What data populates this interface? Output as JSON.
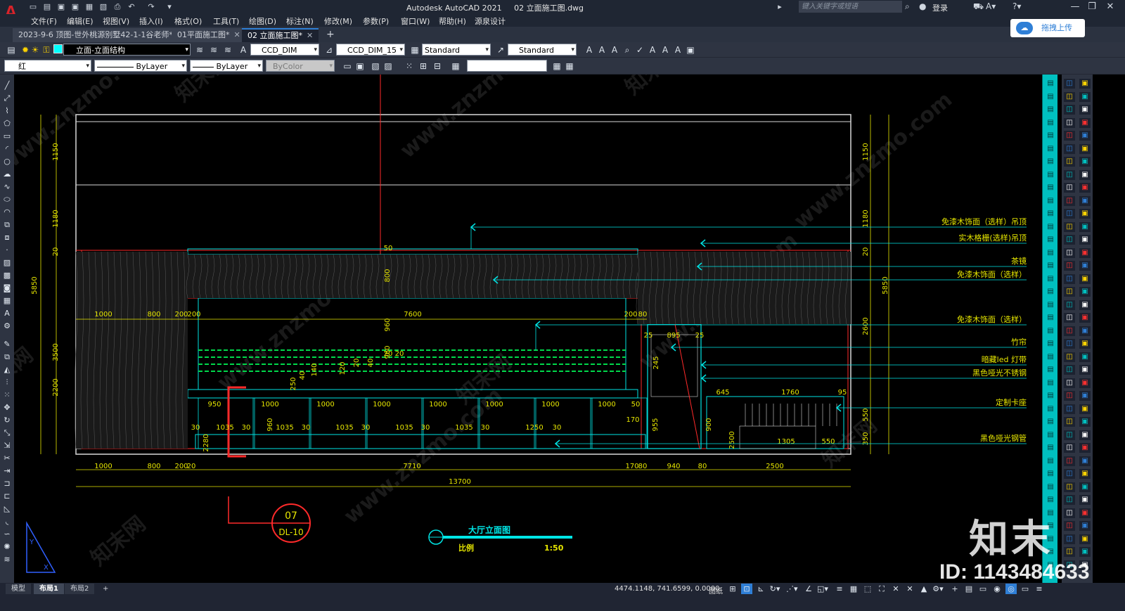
{
  "app": {
    "title": "Autodesk AutoCAD 2021     02 立面施工图.dwg",
    "search_placeholder": "键入关键字或短语",
    "login_label": "登录"
  },
  "menu": [
    "文件(F)",
    "编辑(E)",
    "视图(V)",
    "插入(I)",
    "格式(O)",
    "工具(T)",
    "绘图(D)",
    "标注(N)",
    "修改(M)",
    "参数(P)",
    "窗口(W)",
    "帮助(H)",
    "源泉设计"
  ],
  "tabs": [
    {
      "label": "2023-9-6 顶图-世外桃源别墅42-1-1谷老师*",
      "active": false
    },
    {
      "label": "01平面施工图*",
      "active": false
    },
    {
      "label": "02 立面施工图*",
      "active": true
    }
  ],
  "upload_button": "拖拽上传",
  "toolbar1": {
    "layer": "立面-立面结构",
    "text_style": "CCD_DIM",
    "dim_style": "CCD_DIM_15",
    "table_style": "Standard",
    "mleader_style": "Standard"
  },
  "toolbar2": {
    "color": "红",
    "color_hex": "#ff0000",
    "linetype": "ByLayer",
    "lineweight": "ByLayer",
    "plotstyle": "ByColor"
  },
  "drawing": {
    "title": "大厅立面图",
    "scale_label": "比例",
    "scale": "1:50",
    "symbol_code": "DL-10",
    "symbol_number": "07",
    "callouts": [
      "免漆木饰面（选样）吊顶",
      "实木格栅(选样)吊顶",
      "茶镜",
      "免漆木饰面（选样）",
      "免漆木饰面（选样）",
      "竹帘",
      "暗藏led 灯带",
      "黑色哑光不锈钢",
      "定制卡座",
      "黑色哑光钢管"
    ],
    "dims_top": [
      "1000",
      "800",
      "200",
      "200",
      "7600",
      "200",
      "80"
    ],
    "dims_bottom": [
      "1000",
      "800",
      "200",
      "20",
      "7710",
      "170",
      "80",
      "940",
      "80",
      "2500"
    ],
    "dim_total": "13700",
    "dims_left": [
      "1150",
      "1180",
      "20",
      "3500",
      "2200",
      "5850"
    ],
    "dims_right": [
      "1150",
      "1180",
      "20",
      "2600",
      "550",
      "350",
      "5850"
    ],
    "dims_seat": [
      "950",
      "1000",
      "1000",
      "1000",
      "1000",
      "1000",
      "1000",
      "1000",
      "50"
    ],
    "dims_lower": [
      "30",
      "1035",
      "30",
      "1035",
      "30",
      "1035",
      "30",
      "1035",
      "30",
      "1035",
      "30",
      "1250",
      "30"
    ],
    "dims_misc": [
      "960",
      "800",
      "960",
      "20",
      "50",
      "245",
      "895",
      "25",
      "25",
      "645",
      "1760",
      "95",
      "955",
      "900",
      "1305",
      "550",
      "2500",
      "170",
      "960",
      "250",
      "40",
      "140",
      "120",
      "20",
      "40",
      "2280",
      "20"
    ],
    "watermark_site": "www.znzmo.com",
    "watermark_cn": "知末网"
  },
  "status": {
    "layouts": [
      "模型",
      "布局1",
      "布局2"
    ],
    "active_layout": "布局1",
    "coords": "4474.1148, 741.6599, 0.0000",
    "paper": "图纸"
  },
  "watermark": {
    "brand": "知末",
    "id": "ID: 1143484633"
  },
  "colors": {
    "cyan": "#00e5e5",
    "yellow": "#e6e600",
    "red": "#ff2a2a",
    "green": "#00d84a",
    "white": "#d8d8d8"
  }
}
